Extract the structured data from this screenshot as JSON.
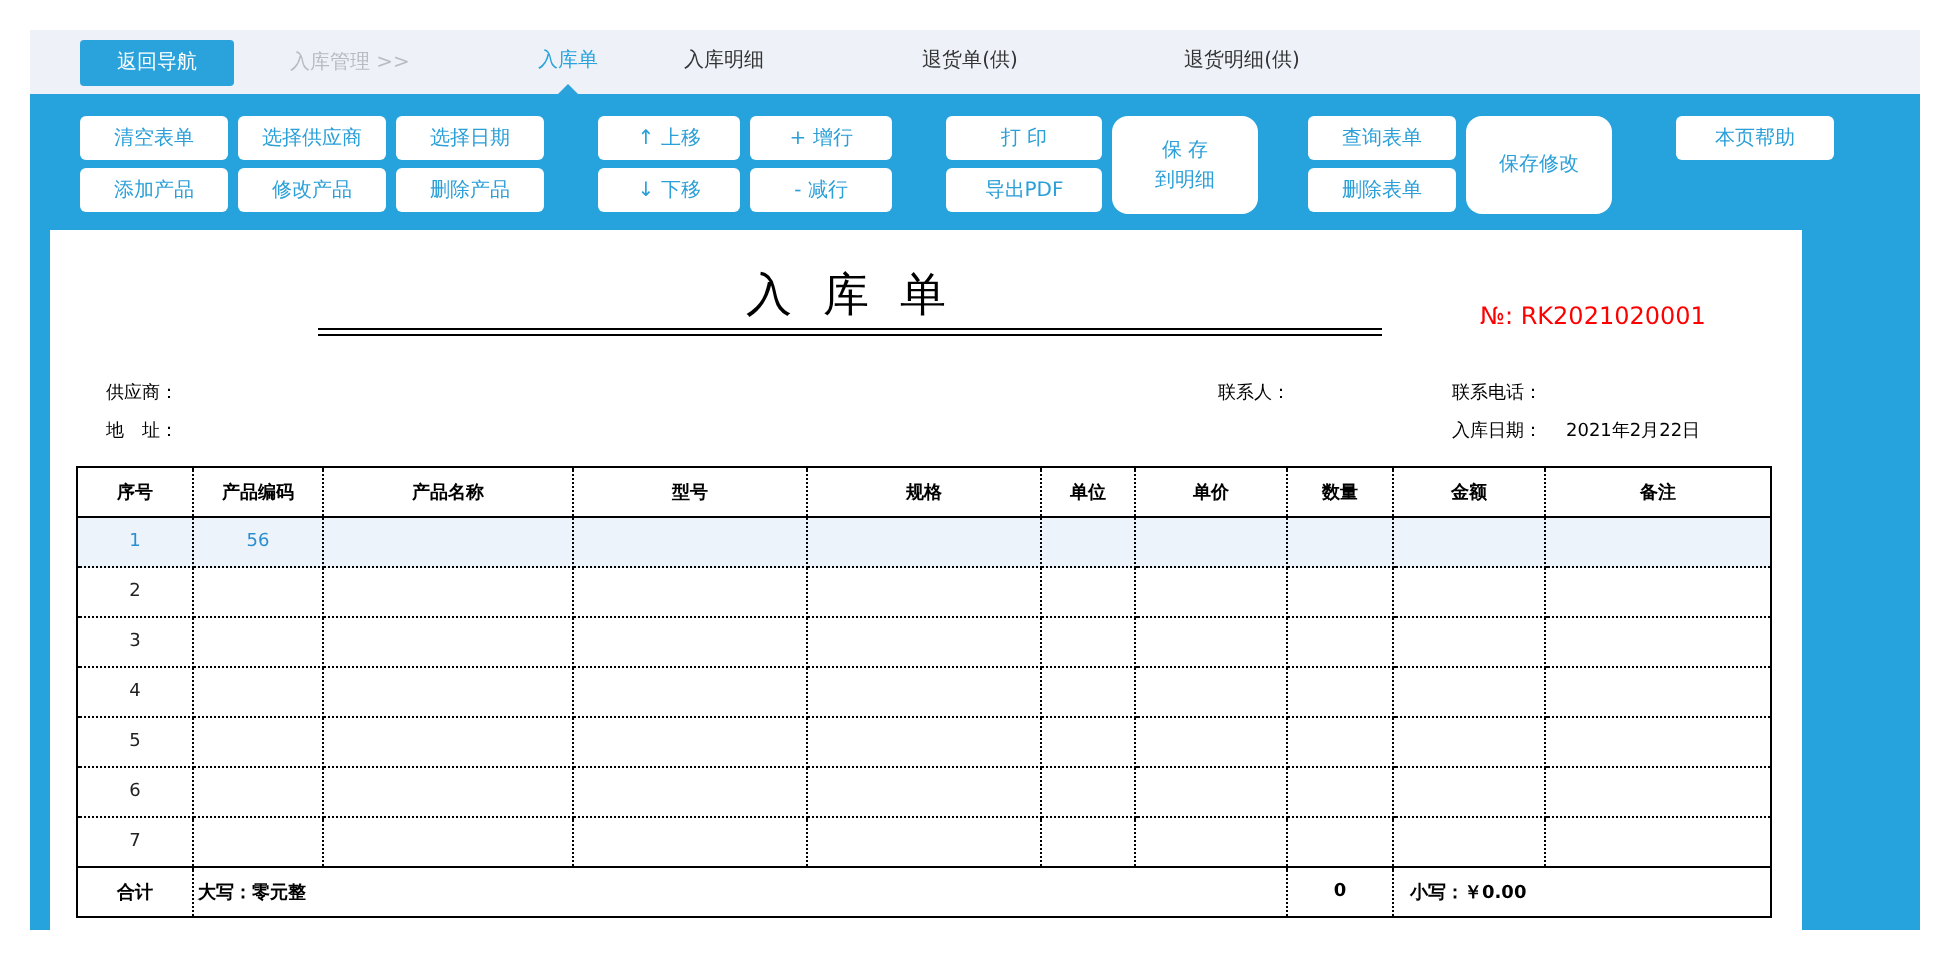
{
  "nav": {
    "back_button": "返回导航",
    "breadcrumb": "入库管理 >>",
    "tabs": [
      {
        "label": "入库单",
        "selected": true
      },
      {
        "label": "入库明细",
        "selected": false
      },
      {
        "label": "退货单(供)",
        "selected": false
      },
      {
        "label": "退货明细(供)",
        "selected": false
      }
    ]
  },
  "toolbar": {
    "groups": [
      {
        "columns": [
          [
            {
              "label": "清空表单",
              "kind": "small"
            },
            {
              "label": "添加产品",
              "kind": "small"
            }
          ],
          [
            {
              "label": "选择供应商",
              "kind": "small"
            },
            {
              "label": "修改产品",
              "kind": "small"
            }
          ],
          [
            {
              "label": "选择日期",
              "kind": "small"
            },
            {
              "label": "删除产品",
              "kind": "small"
            }
          ]
        ]
      },
      {
        "columns": [
          [
            {
              "label": "↑ 上移",
              "kind": "small"
            },
            {
              "label": "↓ 下移",
              "kind": "small"
            }
          ],
          [
            {
              "label": "+ 增行",
              "kind": "small"
            },
            {
              "label": "- 减行",
              "kind": "small"
            }
          ]
        ]
      },
      {
        "columns": [
          [
            {
              "label": "打 印",
              "kind": "small"
            },
            {
              "label": "导出PDF",
              "kind": "small"
            }
          ],
          [
            {
              "lines": [
                "保 存",
                "到明细"
              ],
              "kind": "tall"
            }
          ]
        ]
      },
      {
        "columns": [
          [
            {
              "label": "查询表单",
              "kind": "small"
            },
            {
              "label": "删除表单",
              "kind": "small"
            }
          ],
          [
            {
              "label": "保存修改",
              "kind": "tall"
            }
          ]
        ]
      },
      {
        "columns": [
          [
            {
              "label": "本页帮助",
              "kind": "small"
            }
          ]
        ]
      }
    ]
  },
  "form": {
    "title": "入 库 单",
    "number": "№: RK2021020001",
    "info_rows": [
      {
        "left": {
          "label": "供应商："
        },
        "middle": {
          "label": "联系人："
        },
        "right": {
          "label": "联系电话："
        }
      },
      {
        "left": {
          "label": "地　址："
        },
        "right": {
          "label": "入库日期：",
          "value": "2021年2月22日"
        }
      }
    ],
    "table": {
      "columns": [
        "序号",
        "产品编码",
        "产品名称",
        "型号",
        "规格",
        "单位",
        "单价",
        "数量",
        "金额",
        "备注"
      ],
      "rows": [
        {
          "cells": [
            "1",
            "56"
          ],
          "selected": true
        },
        {
          "cells": [
            "2"
          ],
          "selected": false
        },
        {
          "cells": [
            "3"
          ],
          "selected": false
        },
        {
          "cells": [
            "4"
          ],
          "selected": false
        },
        {
          "cells": [
            "5"
          ],
          "selected": false
        },
        {
          "cells": [
            "6"
          ],
          "selected": false
        },
        {
          "cells": [
            "7"
          ],
          "selected": false
        }
      ],
      "footer": {
        "label": "合计",
        "amount_in_words": "大写：零元整",
        "quantity": "0",
        "amount": "小写：￥0.00"
      }
    }
  }
}
